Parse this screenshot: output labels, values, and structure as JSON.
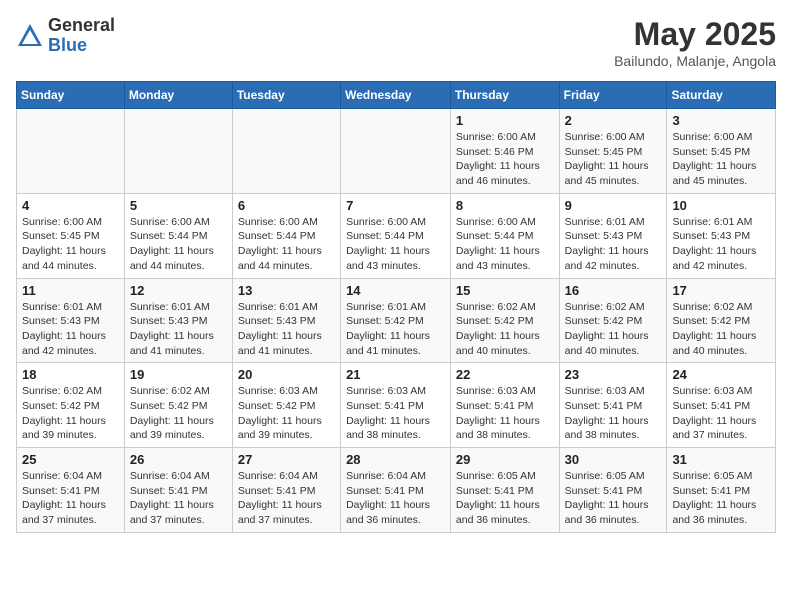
{
  "logo": {
    "general": "General",
    "blue": "Blue"
  },
  "title": "May 2025",
  "location": "Bailundo, Malanje, Angola",
  "days_header": [
    "Sunday",
    "Monday",
    "Tuesday",
    "Wednesday",
    "Thursday",
    "Friday",
    "Saturday"
  ],
  "weeks": [
    [
      {
        "day": "",
        "info": ""
      },
      {
        "day": "",
        "info": ""
      },
      {
        "day": "",
        "info": ""
      },
      {
        "day": "",
        "info": ""
      },
      {
        "day": "1",
        "info": "Sunrise: 6:00 AM\nSunset: 5:46 PM\nDaylight: 11 hours\nand 46 minutes."
      },
      {
        "day": "2",
        "info": "Sunrise: 6:00 AM\nSunset: 5:45 PM\nDaylight: 11 hours\nand 45 minutes."
      },
      {
        "day": "3",
        "info": "Sunrise: 6:00 AM\nSunset: 5:45 PM\nDaylight: 11 hours\nand 45 minutes."
      }
    ],
    [
      {
        "day": "4",
        "info": "Sunrise: 6:00 AM\nSunset: 5:45 PM\nDaylight: 11 hours\nand 44 minutes."
      },
      {
        "day": "5",
        "info": "Sunrise: 6:00 AM\nSunset: 5:44 PM\nDaylight: 11 hours\nand 44 minutes."
      },
      {
        "day": "6",
        "info": "Sunrise: 6:00 AM\nSunset: 5:44 PM\nDaylight: 11 hours\nand 44 minutes."
      },
      {
        "day": "7",
        "info": "Sunrise: 6:00 AM\nSunset: 5:44 PM\nDaylight: 11 hours\nand 43 minutes."
      },
      {
        "day": "8",
        "info": "Sunrise: 6:00 AM\nSunset: 5:44 PM\nDaylight: 11 hours\nand 43 minutes."
      },
      {
        "day": "9",
        "info": "Sunrise: 6:01 AM\nSunset: 5:43 PM\nDaylight: 11 hours\nand 42 minutes."
      },
      {
        "day": "10",
        "info": "Sunrise: 6:01 AM\nSunset: 5:43 PM\nDaylight: 11 hours\nand 42 minutes."
      }
    ],
    [
      {
        "day": "11",
        "info": "Sunrise: 6:01 AM\nSunset: 5:43 PM\nDaylight: 11 hours\nand 42 minutes."
      },
      {
        "day": "12",
        "info": "Sunrise: 6:01 AM\nSunset: 5:43 PM\nDaylight: 11 hours\nand 41 minutes."
      },
      {
        "day": "13",
        "info": "Sunrise: 6:01 AM\nSunset: 5:43 PM\nDaylight: 11 hours\nand 41 minutes."
      },
      {
        "day": "14",
        "info": "Sunrise: 6:01 AM\nSunset: 5:42 PM\nDaylight: 11 hours\nand 41 minutes."
      },
      {
        "day": "15",
        "info": "Sunrise: 6:02 AM\nSunset: 5:42 PM\nDaylight: 11 hours\nand 40 minutes."
      },
      {
        "day": "16",
        "info": "Sunrise: 6:02 AM\nSunset: 5:42 PM\nDaylight: 11 hours\nand 40 minutes."
      },
      {
        "day": "17",
        "info": "Sunrise: 6:02 AM\nSunset: 5:42 PM\nDaylight: 11 hours\nand 40 minutes."
      }
    ],
    [
      {
        "day": "18",
        "info": "Sunrise: 6:02 AM\nSunset: 5:42 PM\nDaylight: 11 hours\nand 39 minutes."
      },
      {
        "day": "19",
        "info": "Sunrise: 6:02 AM\nSunset: 5:42 PM\nDaylight: 11 hours\nand 39 minutes."
      },
      {
        "day": "20",
        "info": "Sunrise: 6:03 AM\nSunset: 5:42 PM\nDaylight: 11 hours\nand 39 minutes."
      },
      {
        "day": "21",
        "info": "Sunrise: 6:03 AM\nSunset: 5:41 PM\nDaylight: 11 hours\nand 38 minutes."
      },
      {
        "day": "22",
        "info": "Sunrise: 6:03 AM\nSunset: 5:41 PM\nDaylight: 11 hours\nand 38 minutes."
      },
      {
        "day": "23",
        "info": "Sunrise: 6:03 AM\nSunset: 5:41 PM\nDaylight: 11 hours\nand 38 minutes."
      },
      {
        "day": "24",
        "info": "Sunrise: 6:03 AM\nSunset: 5:41 PM\nDaylight: 11 hours\nand 37 minutes."
      }
    ],
    [
      {
        "day": "25",
        "info": "Sunrise: 6:04 AM\nSunset: 5:41 PM\nDaylight: 11 hours\nand 37 minutes."
      },
      {
        "day": "26",
        "info": "Sunrise: 6:04 AM\nSunset: 5:41 PM\nDaylight: 11 hours\nand 37 minutes."
      },
      {
        "day": "27",
        "info": "Sunrise: 6:04 AM\nSunset: 5:41 PM\nDaylight: 11 hours\nand 37 minutes."
      },
      {
        "day": "28",
        "info": "Sunrise: 6:04 AM\nSunset: 5:41 PM\nDaylight: 11 hours\nand 36 minutes."
      },
      {
        "day": "29",
        "info": "Sunrise: 6:05 AM\nSunset: 5:41 PM\nDaylight: 11 hours\nand 36 minutes."
      },
      {
        "day": "30",
        "info": "Sunrise: 6:05 AM\nSunset: 5:41 PM\nDaylight: 11 hours\nand 36 minutes."
      },
      {
        "day": "31",
        "info": "Sunrise: 6:05 AM\nSunset: 5:41 PM\nDaylight: 11 hours\nand 36 minutes."
      }
    ]
  ]
}
